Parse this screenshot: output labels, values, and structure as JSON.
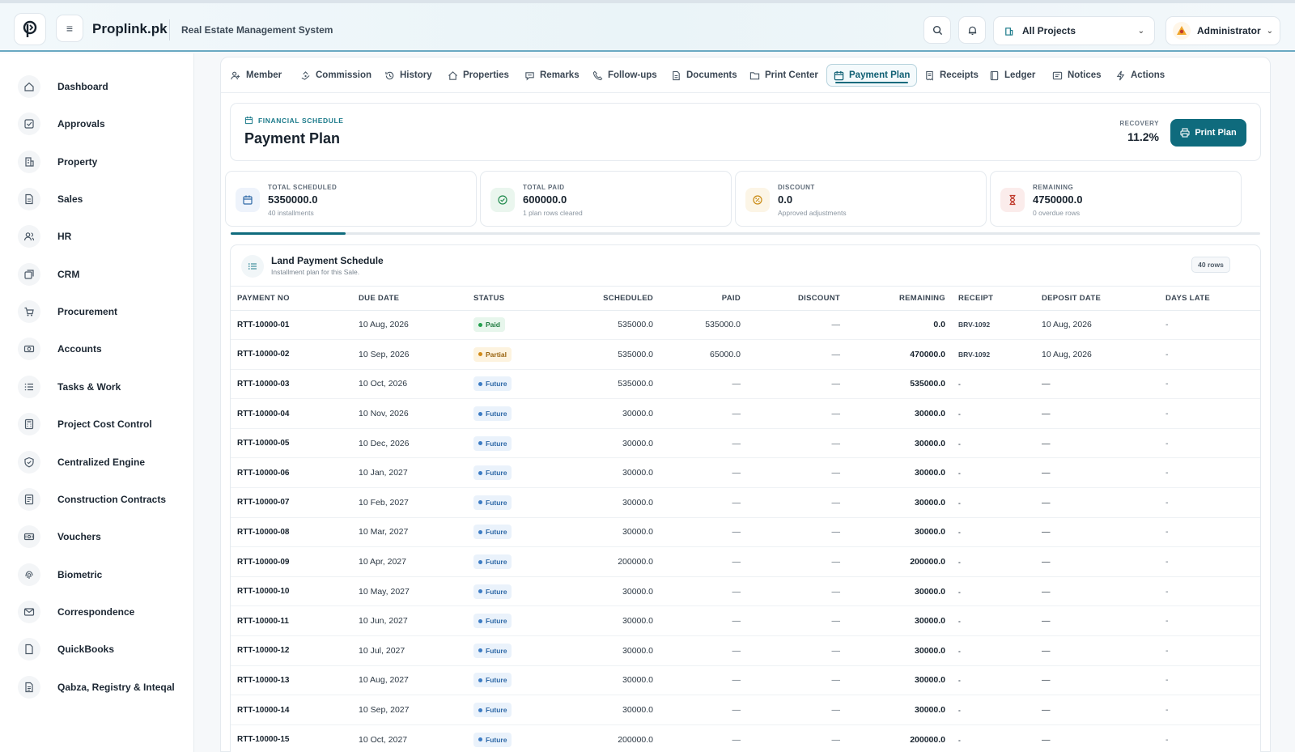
{
  "header": {
    "brand": "Proplink.pk",
    "subtitle": "Real Estate Management System",
    "project_select": "All Projects",
    "user": "Administrator"
  },
  "sidebar": {
    "items": [
      {
        "label": "Dashboard",
        "icon": "home-icon"
      },
      {
        "label": "Approvals",
        "icon": "check-square-icon"
      },
      {
        "label": "Property",
        "icon": "building-icon"
      },
      {
        "label": "Sales",
        "icon": "document-icon"
      },
      {
        "label": "HR",
        "icon": "users-icon"
      },
      {
        "label": "CRM",
        "icon": "cards-icon"
      },
      {
        "label": "Procurement",
        "icon": "cart-icon"
      },
      {
        "label": "Accounts",
        "icon": "cash-icon"
      },
      {
        "label": "Tasks & Work",
        "icon": "list-icon"
      },
      {
        "label": "Project Cost Control",
        "icon": "calculator-icon"
      },
      {
        "label": "Centralized Engine",
        "icon": "shield-icon"
      },
      {
        "label": "Construction Contracts",
        "icon": "contract-icon"
      },
      {
        "label": "Vouchers",
        "icon": "voucher-icon"
      },
      {
        "label": "Biometric",
        "icon": "fingerprint-icon"
      },
      {
        "label": "Correspondence",
        "icon": "mail-icon"
      },
      {
        "label": "QuickBooks",
        "icon": "book-icon"
      },
      {
        "label": "Qabza, Registry & Inteqal",
        "icon": "registry-icon"
      }
    ]
  },
  "tabs": [
    {
      "label": "Member",
      "icon": "member-icon"
    },
    {
      "label": "Commission",
      "icon": "commission-icon"
    },
    {
      "label": "History",
      "icon": "history-icon"
    },
    {
      "label": "Properties",
      "icon": "properties-icon"
    },
    {
      "label": "Remarks",
      "icon": "chat-icon"
    },
    {
      "label": "Follow-ups",
      "icon": "phone-icon"
    },
    {
      "label": "Documents",
      "icon": "file-icon"
    },
    {
      "label": "Print Center",
      "icon": "folder-icon"
    },
    {
      "label": "Payment Plan",
      "icon": "calendar-icon",
      "active": true
    },
    {
      "label": "Receipts",
      "icon": "receipt-icon"
    },
    {
      "label": "Ledger",
      "icon": "ledger-icon"
    },
    {
      "label": "Notices",
      "icon": "notice-icon"
    },
    {
      "label": "Actions",
      "icon": "bolt-icon"
    }
  ],
  "plan": {
    "eyebrow": "FINANCIAL SCHEDULE",
    "title": "Payment Plan",
    "recovery_label": "RECOVERY",
    "recovery_value": "11.2%",
    "recovery_fraction": 0.112,
    "print_label": "Print Plan"
  },
  "stats": [
    {
      "label": "TOTAL SCHEDULED",
      "value": "5350000.0",
      "sub": "40 installments",
      "icon": "calendar-icon",
      "color": "#2f69a7"
    },
    {
      "label": "TOTAL PAID",
      "value": "600000.0",
      "sub": "1 plan rows cleared",
      "icon": "check-circle-icon",
      "color": "#1f8a4c"
    },
    {
      "label": "DISCOUNT",
      "value": "0.0",
      "sub": "Approved adjustments",
      "icon": "discount-icon",
      "color": "#c98a12"
    },
    {
      "label": "REMAINING",
      "value": "4750000.0",
      "sub": "0 overdue rows",
      "icon": "hourglass-icon",
      "color": "#c0392b"
    }
  ],
  "schedule": {
    "title": "Land Payment Schedule",
    "subtitle": "Installment plan for this Sale.",
    "rows_badge": "40 rows",
    "columns": [
      "PAYMENT NO",
      "DUE DATE",
      "STATUS",
      "SCHEDULED",
      "PAID",
      "DISCOUNT",
      "REMAINING",
      "RECEIPT",
      "DEPOSIT DATE",
      "DAYS LATE"
    ],
    "rows": [
      {
        "no": "RTT-10000-01",
        "due": "10 Aug, 2026",
        "status": "Paid",
        "scheduled": "535000.0",
        "paid": "535000.0",
        "discount": "—",
        "remaining": "0.0",
        "receipt": "BRV-1092",
        "deposit": "10 Aug, 2026",
        "late": "-"
      },
      {
        "no": "RTT-10000-02",
        "due": "10 Sep, 2026",
        "status": "Partial",
        "scheduled": "535000.0",
        "paid": "65000.0",
        "discount": "—",
        "remaining": "470000.0",
        "receipt": "BRV-1092",
        "deposit": "10 Aug, 2026",
        "late": "-"
      },
      {
        "no": "RTT-10000-03",
        "due": "10 Oct, 2026",
        "status": "Future",
        "scheduled": "535000.0",
        "paid": "—",
        "discount": "—",
        "remaining": "535000.0",
        "receipt": "-",
        "deposit": "—",
        "late": "-"
      },
      {
        "no": "RTT-10000-04",
        "due": "10 Nov, 2026",
        "status": "Future",
        "scheduled": "30000.0",
        "paid": "—",
        "discount": "—",
        "remaining": "30000.0",
        "receipt": "-",
        "deposit": "—",
        "late": "-"
      },
      {
        "no": "RTT-10000-05",
        "due": "10 Dec, 2026",
        "status": "Future",
        "scheduled": "30000.0",
        "paid": "—",
        "discount": "—",
        "remaining": "30000.0",
        "receipt": "-",
        "deposit": "—",
        "late": "-"
      },
      {
        "no": "RTT-10000-06",
        "due": "10 Jan, 2027",
        "status": "Future",
        "scheduled": "30000.0",
        "paid": "—",
        "discount": "—",
        "remaining": "30000.0",
        "receipt": "-",
        "deposit": "—",
        "late": "-"
      },
      {
        "no": "RTT-10000-07",
        "due": "10 Feb, 2027",
        "status": "Future",
        "scheduled": "30000.0",
        "paid": "—",
        "discount": "—",
        "remaining": "30000.0",
        "receipt": "-",
        "deposit": "—",
        "late": "-"
      },
      {
        "no": "RTT-10000-08",
        "due": "10 Mar, 2027",
        "status": "Future",
        "scheduled": "30000.0",
        "paid": "—",
        "discount": "—",
        "remaining": "30000.0",
        "receipt": "-",
        "deposit": "—",
        "late": "-"
      },
      {
        "no": "RTT-10000-09",
        "due": "10 Apr, 2027",
        "status": "Future",
        "scheduled": "200000.0",
        "paid": "—",
        "discount": "—",
        "remaining": "200000.0",
        "receipt": "-",
        "deposit": "—",
        "late": "-"
      },
      {
        "no": "RTT-10000-10",
        "due": "10 May, 2027",
        "status": "Future",
        "scheduled": "30000.0",
        "paid": "—",
        "discount": "—",
        "remaining": "30000.0",
        "receipt": "-",
        "deposit": "—",
        "late": "-"
      },
      {
        "no": "RTT-10000-11",
        "due": "10 Jun, 2027",
        "status": "Future",
        "scheduled": "30000.0",
        "paid": "—",
        "discount": "—",
        "remaining": "30000.0",
        "receipt": "-",
        "deposit": "—",
        "late": "-"
      },
      {
        "no": "RTT-10000-12",
        "due": "10 Jul, 2027",
        "status": "Future",
        "scheduled": "30000.0",
        "paid": "—",
        "discount": "—",
        "remaining": "30000.0",
        "receipt": "-",
        "deposit": "—",
        "late": "-"
      },
      {
        "no": "RTT-10000-13",
        "due": "10 Aug, 2027",
        "status": "Future",
        "scheduled": "30000.0",
        "paid": "—",
        "discount": "—",
        "remaining": "30000.0",
        "receipt": "-",
        "deposit": "—",
        "late": "-"
      },
      {
        "no": "RTT-10000-14",
        "due": "10 Sep, 2027",
        "status": "Future",
        "scheduled": "30000.0",
        "paid": "—",
        "discount": "—",
        "remaining": "30000.0",
        "receipt": "-",
        "deposit": "—",
        "late": "-"
      },
      {
        "no": "RTT-10000-15",
        "due": "10 Oct, 2027",
        "status": "Future",
        "scheduled": "200000.0",
        "paid": "—",
        "discount": "—",
        "remaining": "200000.0",
        "receipt": "-",
        "deposit": "—",
        "late": "-"
      }
    ]
  }
}
